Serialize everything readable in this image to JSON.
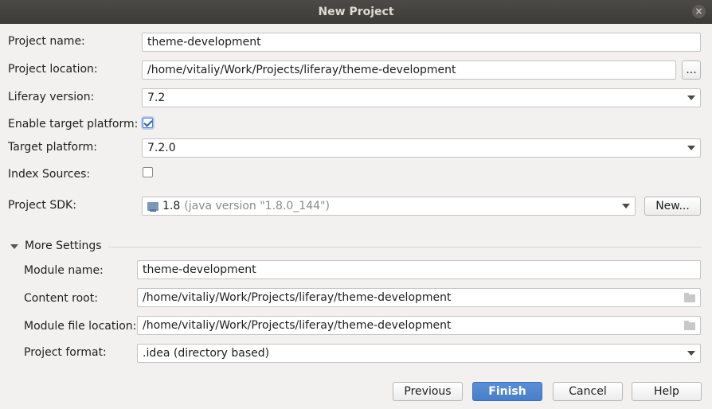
{
  "window": {
    "title": "New Project"
  },
  "fields": {
    "project_name": {
      "label": "Project name:",
      "value": "theme-development"
    },
    "project_location": {
      "label": "Project location:",
      "value": "/home/vitaliy/Work/Projects/liferay/theme-development",
      "browse_label": "..."
    },
    "liferay_version": {
      "label": "Liferay version:",
      "value": "7.2"
    },
    "enable_target_platform": {
      "label": "Enable target platform:",
      "checked": true
    },
    "target_platform": {
      "label": "Target platform:",
      "value": "7.2.0"
    },
    "index_sources": {
      "label": "Index Sources:",
      "checked": false
    },
    "project_sdk": {
      "label": "Project SDK:",
      "value": "1.8",
      "detail": "(java version \"1.8.0_144\")",
      "new_label": "New..."
    }
  },
  "more_settings": {
    "label": "More Settings",
    "module_name": {
      "label": "Module name:",
      "value": "theme-development"
    },
    "content_root": {
      "label": "Content root:",
      "value": "/home/vitaliy/Work/Projects/liferay/theme-development"
    },
    "module_file_location": {
      "label": "Module file location:",
      "value": "/home/vitaliy/Work/Projects/liferay/theme-development"
    },
    "project_format": {
      "label": "Project format:",
      "value": ".idea (directory based)"
    }
  },
  "buttons": {
    "previous": "Previous",
    "finish": "Finish",
    "cancel": "Cancel",
    "help": "Help"
  },
  "icons": {
    "close": "close-icon",
    "folder": "folder-icon",
    "sdk": "sdk-icon",
    "dropdown": "chevron-down-icon",
    "collapse": "triangle-down-icon"
  },
  "colors": {
    "titlebar": "#3c3b37",
    "background": "#f2f1f0",
    "accent": "#4a7fc8"
  }
}
